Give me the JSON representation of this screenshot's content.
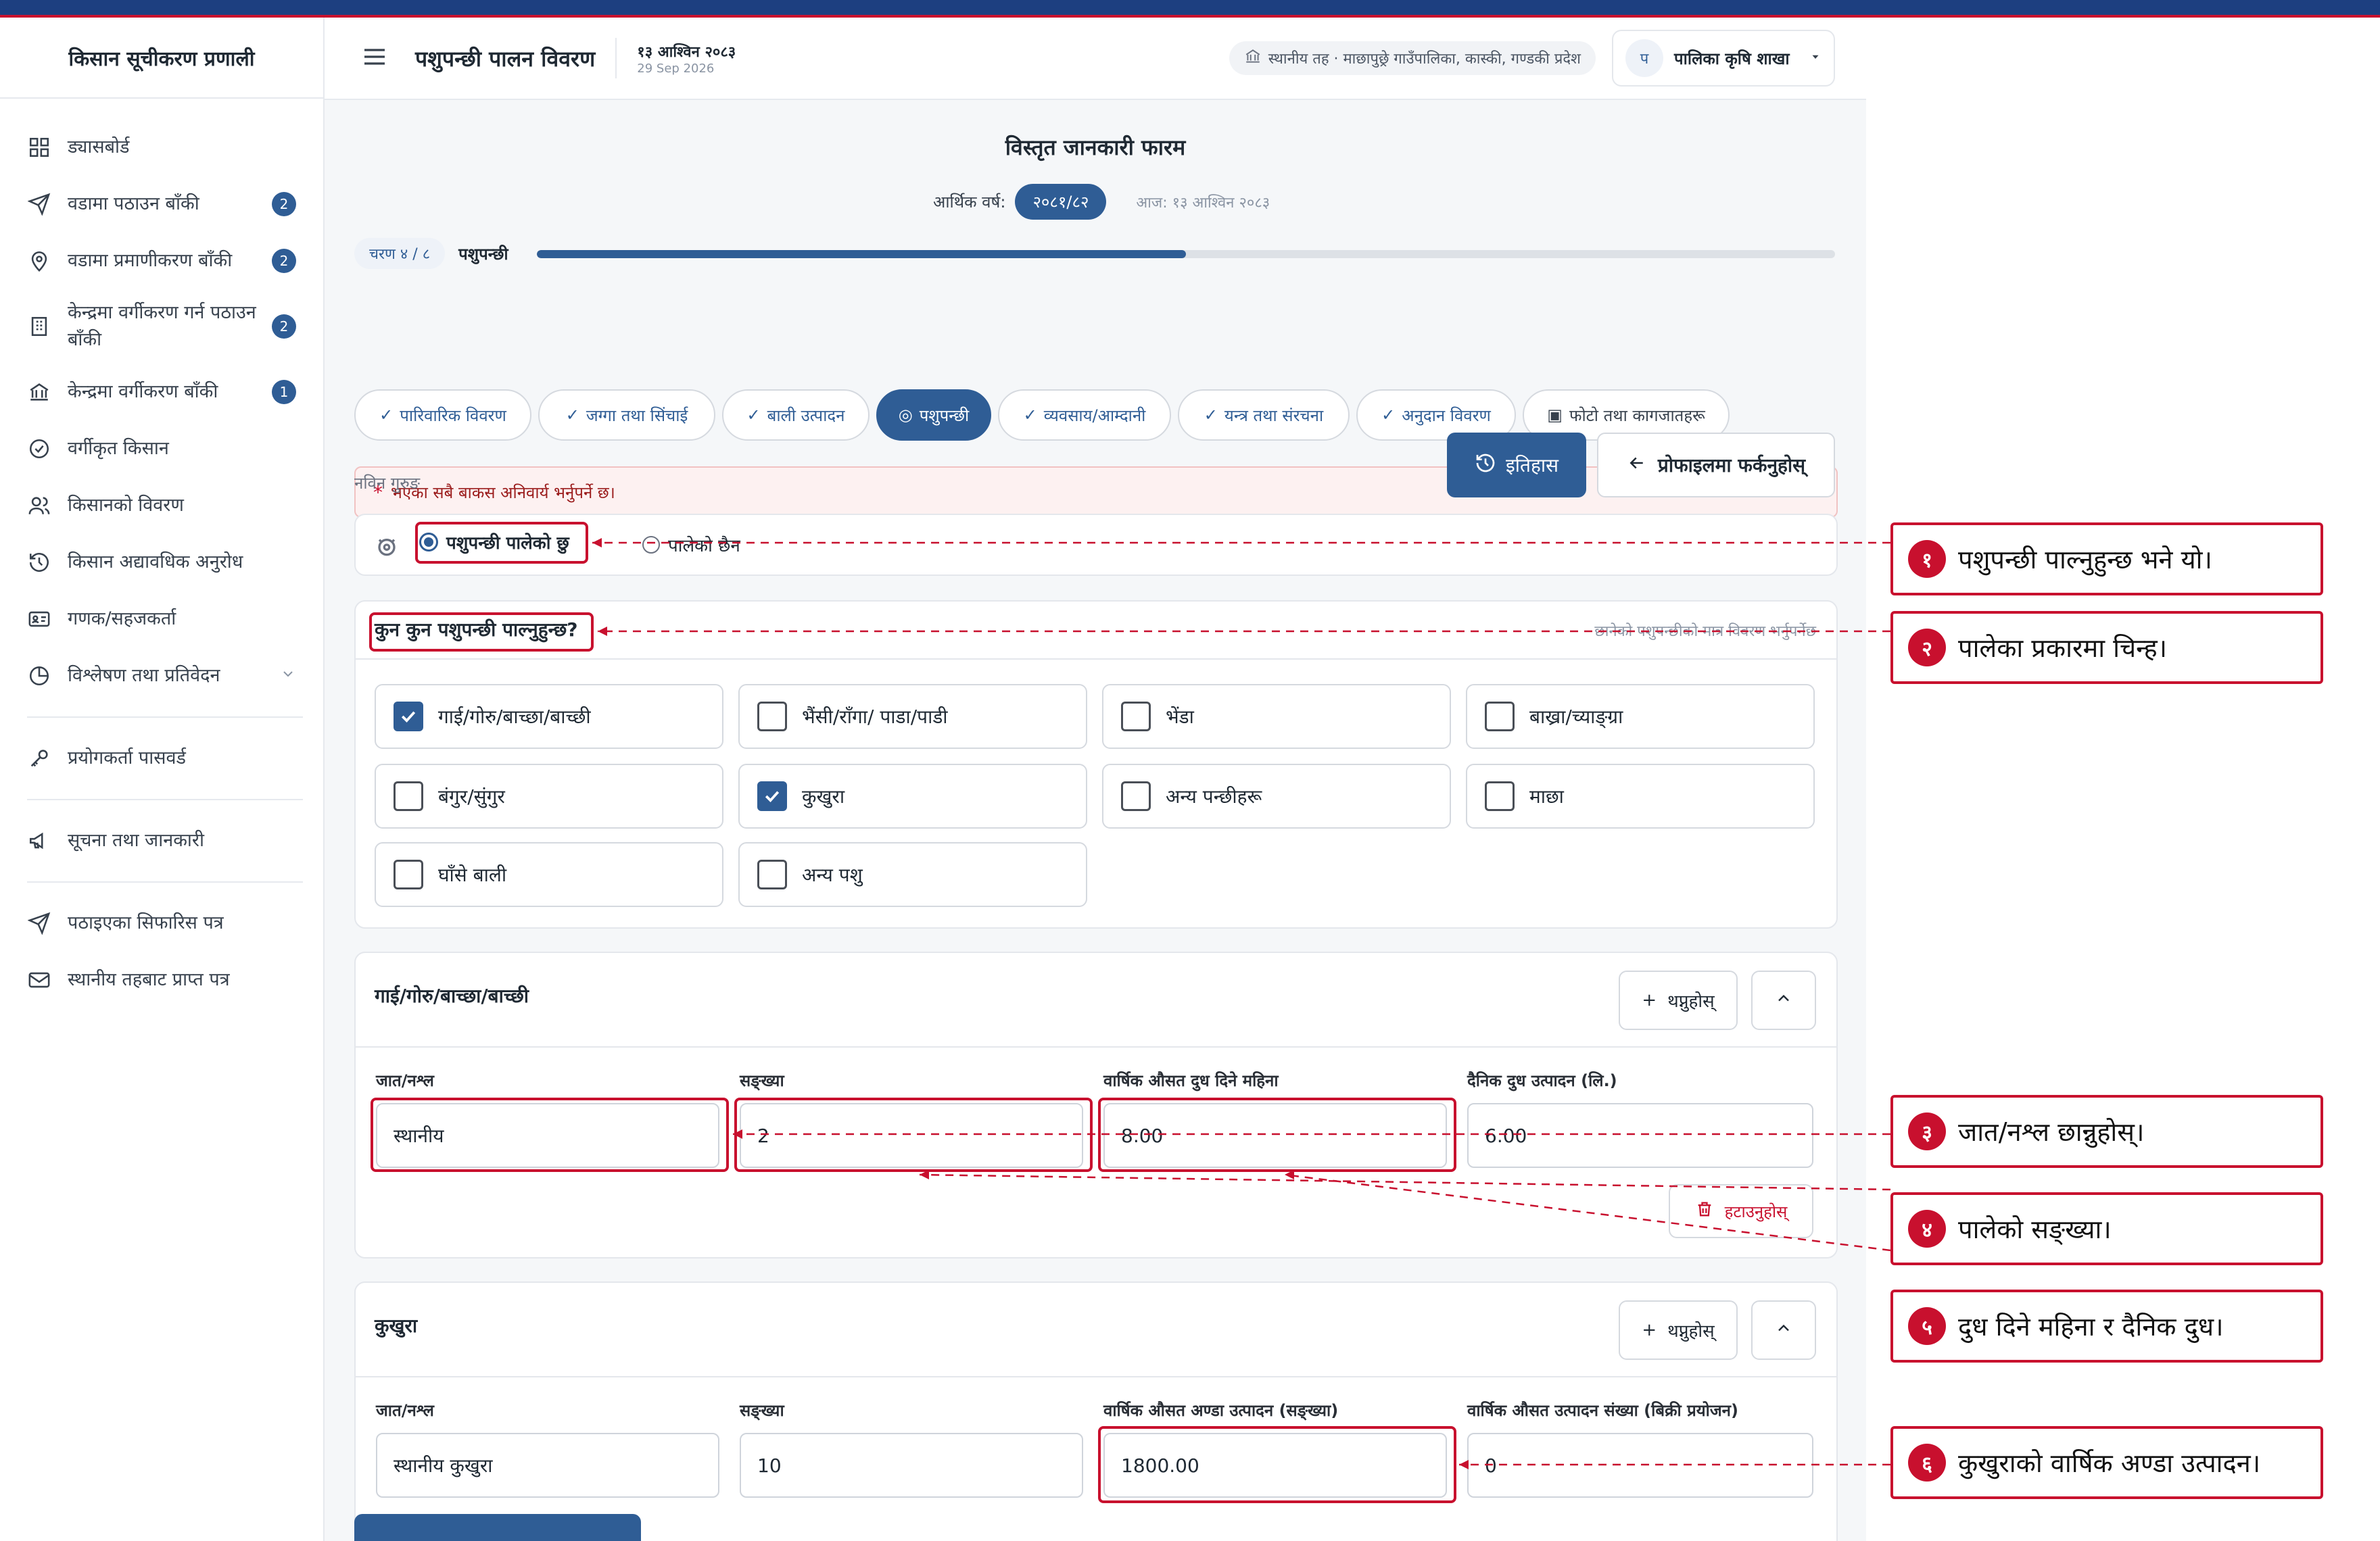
{
  "sidebar": {
    "brand": "किसान सूचीकरण प्रणाली",
    "items": [
      {
        "label": "ड्यासबोर्ड",
        "badge": ""
      },
      {
        "label": "वडामा पठाउन बाँकी",
        "badge": "2"
      },
      {
        "label": "वडामा प्रमाणीकरण बाँकी",
        "badge": "2"
      },
      {
        "label": "केन्द्रमा वर्गीकरण गर्न पठाउन बाँकी",
        "badge": "2"
      },
      {
        "label": "केन्द्रमा वर्गीकरण बाँकी",
        "badge": "1"
      },
      {
        "label": "वर्गीकृत किसान",
        "badge": ""
      },
      {
        "label": "किसानको विवरण",
        "badge": ""
      },
      {
        "label": "किसान अद्यावधिक अनुरोध",
        "badge": ""
      },
      {
        "label": "गणक/सहजकर्ता",
        "badge": ""
      },
      {
        "label": "विश्लेषण तथा प्रतिवेदन",
        "badge": ""
      },
      {
        "label": "प्रयोगकर्ता पासवर्ड",
        "badge": ""
      },
      {
        "label": "सूचना तथा जानकारी",
        "badge": ""
      },
      {
        "label": "पठाइएका सिफारिस पत्र",
        "badge": ""
      },
      {
        "label": "स्थानीय तहबाट प्राप्त पत्र",
        "badge": ""
      }
    ]
  },
  "header": {
    "title": "पशुपन्छी पालन विवरण",
    "date_np": "१३ आश्विन २०८३",
    "date_en": "29 Sep 2026",
    "location": "स्थानीय तह · माछापुछ्रे गाउँपालिका, कास्की, गण्डकी प्रदेश",
    "user_initial": "प",
    "user_name": "पालिका कृषि शाखा"
  },
  "form": {
    "title": "विस्तृत जानकारी फारम",
    "fy_label": "आर्थिक वर्ष:",
    "fy_value": "२०८१/८२",
    "today": "आज: १३ आश्विन २०८३",
    "step_label": "चरण ४ / ८",
    "step_name": "पशुपन्छी",
    "progress": 0.5,
    "tabs": [
      "पारिवारिक विवरण",
      "जग्गा तथा सिंचाई",
      "बाली उत्पादन",
      "पशुपन्छी",
      "व्यवसाय/आम्दानी",
      "यन्त्र तथा संरचना",
      "अनुदान विवरण",
      "फोटो तथा कागजातहरू"
    ],
    "required_note": "भएका सबै बाकस अनिवार्य भर्नुपर्ने छ।",
    "history_btn": "इतिहास",
    "back_btn": "प्रोफाइलमा फर्कनुहोस्",
    "farmer_name": "नविन गुरुङ",
    "radio_yes": "पशुपन्छी पालेको छु",
    "radio_no": "पालेको छैन",
    "question": "कुन कुन पशुपन्छी पाल्नुहुन्छ?",
    "question_hint": "छानेको पशुपन्छीको मात्र विवरण भर्नुपर्नेछ",
    "options": [
      {
        "label": "गाई/गोरु/बाच्छा/बाच्छी",
        "checked": true
      },
      {
        "label": "भैंसी/राँगा/ पाडा/पाडी",
        "checked": false
      },
      {
        "label": "भेंडा",
        "checked": false
      },
      {
        "label": "बाख्रा/च्याङ्ग्रा",
        "checked": false
      },
      {
        "label": "बंगुर/सुंगुर",
        "checked": false
      },
      {
        "label": "कुखुरा",
        "checked": true
      },
      {
        "label": "अन्य पन्छीहरू",
        "checked": false
      },
      {
        "label": "माछा",
        "checked": false
      },
      {
        "label": "घाँसे बाली",
        "checked": false
      },
      {
        "label": "अन्य पशु",
        "checked": false
      }
    ],
    "add_btn": "थप्नुहोस्",
    "remove_btn": "हटाउनुहोस्",
    "cattle": {
      "title": "गाई/गोरु/बाच्छा/बाच्छी",
      "labels": [
        "जात/नश्ल",
        "सङ्ख्या",
        "वार्षिक औसत दुध दिने महिना",
        "दैनिक दुध उत्पादन (लि.)"
      ],
      "values": [
        "स्थानीय",
        "2",
        "8.00",
        "6.00"
      ]
    },
    "chicken": {
      "title": "कुखुरा",
      "labels": [
        "जात/नश्ल",
        "सङ्ख्या",
        "वार्षिक औसत अण्डा उत्पादन (सङ्ख्या)",
        "वार्षिक औसत उत्पादन संख्या (बिक्री प्रयोजन)"
      ],
      "values": [
        "स्थानीय कुखुरा",
        "10",
        "1800.00",
        "0"
      ]
    }
  },
  "callouts": [
    {
      "num": "१",
      "text": "पशुपन्छी पाल्नुहुन्छ भने यो।"
    },
    {
      "num": "२",
      "text": "पालेका प्रकारमा चिन्ह।"
    },
    {
      "num": "३",
      "text": "जात/नश्ल छान्नुहोस्।"
    },
    {
      "num": "४",
      "text": "पालेको सङ्ख्या।"
    },
    {
      "num": "५",
      "text": "दुध दिने महिना र दैनिक दुध।"
    },
    {
      "num": "६",
      "text": "कुखुराको वार्षिक अण्डा उत्पादन।"
    }
  ],
  "colors": {
    "primary": "#2f5d95",
    "accent_red": "#c8102e",
    "top_bar": "#1d3f80"
  },
  "icons": [
    "menu-icon",
    "building-icon",
    "chevron-down-icon",
    "check-icon",
    "history-icon",
    "arrow-left-icon",
    "plus-icon",
    "chevron-up-icon",
    "trash-icon",
    "image-icon",
    "paw-icon"
  ]
}
